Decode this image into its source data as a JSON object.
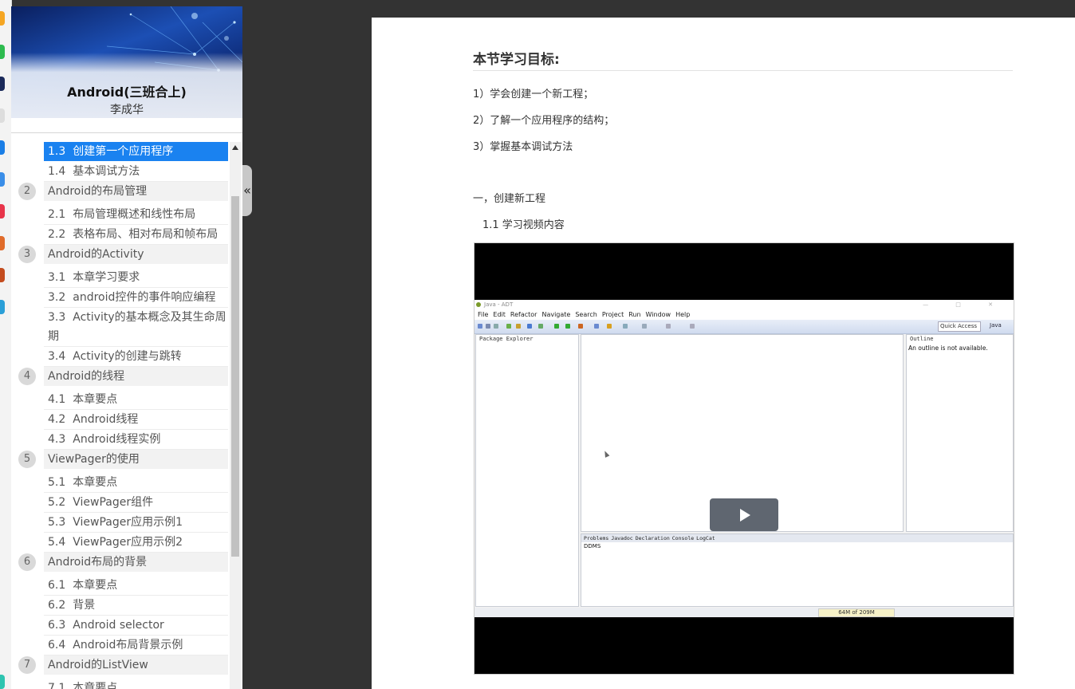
{
  "course": {
    "title": "Android(三班合上)",
    "teacher": "李成华"
  },
  "toc": {
    "collapse_icon": "«",
    "chapters": [
      {
        "num": "2",
        "title": "Android的布局管理"
      },
      {
        "num": "3",
        "title": "Android的Activity"
      },
      {
        "num": "4",
        "title": "Android的线程"
      },
      {
        "num": "5",
        "title": "ViewPager的使用"
      },
      {
        "num": "6",
        "title": "Android布局的背景"
      },
      {
        "num": "7",
        "title": "Android的ListView"
      }
    ],
    "sections": [
      {
        "num": "1.3",
        "title": "创建第一个应用程序",
        "active": true
      },
      {
        "num": "1.4",
        "title": "基本调试方法"
      },
      {
        "num": "2.1",
        "title": "布局管理概述和线性布局"
      },
      {
        "num": "2.2",
        "title": "表格布局、相对布局和帧布局"
      },
      {
        "num": "3.1",
        "title": "本章学习要求"
      },
      {
        "num": "3.2",
        "title": "android控件的事件响应编程"
      },
      {
        "num": "3.3",
        "title": "Activity的基本概念及其生命周期"
      },
      {
        "num": "3.4",
        "title": "Activity的创建与跳转"
      },
      {
        "num": "4.1",
        "title": "本章要点"
      },
      {
        "num": "4.2",
        "title": "Android线程"
      },
      {
        "num": "4.3",
        "title": "Android线程实例"
      },
      {
        "num": "5.1",
        "title": "本章要点"
      },
      {
        "num": "5.2",
        "title": "ViewPager组件"
      },
      {
        "num": "5.3",
        "title": "ViewPager应用示例1"
      },
      {
        "num": "5.4",
        "title": "ViewPager应用示例2"
      },
      {
        "num": "6.1",
        "title": "本章要点"
      },
      {
        "num": "6.2",
        "title": "背景"
      },
      {
        "num": "6.3",
        "title": "Android selector"
      },
      {
        "num": "6.4",
        "title": "Android布局背景示例"
      },
      {
        "num": "7.1",
        "title": "本章要点"
      }
    ]
  },
  "content": {
    "heading": "本节学习目标:",
    "goals": [
      "1）学会创建一个新工程；",
      "2）了解一个应用程序的结构；",
      "3）掌握基本调试方法"
    ],
    "section1": "一，创建新工程",
    "section1_1": "1.1 学习视频内容"
  },
  "video": {
    "play_icon": "play-icon",
    "screen": {
      "window_title": "Java - ADT",
      "menu": [
        "File",
        "Edit",
        "Refactor",
        "Navigate",
        "Search",
        "Project",
        "Run",
        "Window",
        "Help"
      ],
      "quick_access": "Quick Access",
      "perspective": "Java",
      "package_explorer": "Package Explorer",
      "outline_tab": "Outline",
      "outline_msg": "An outline is not available.",
      "console_tabs": [
        "Problems",
        "Javadoc",
        "Declaration",
        "Console",
        "LogCat"
      ],
      "console_text": "DDMS",
      "heap": "64M of 209M"
    }
  }
}
